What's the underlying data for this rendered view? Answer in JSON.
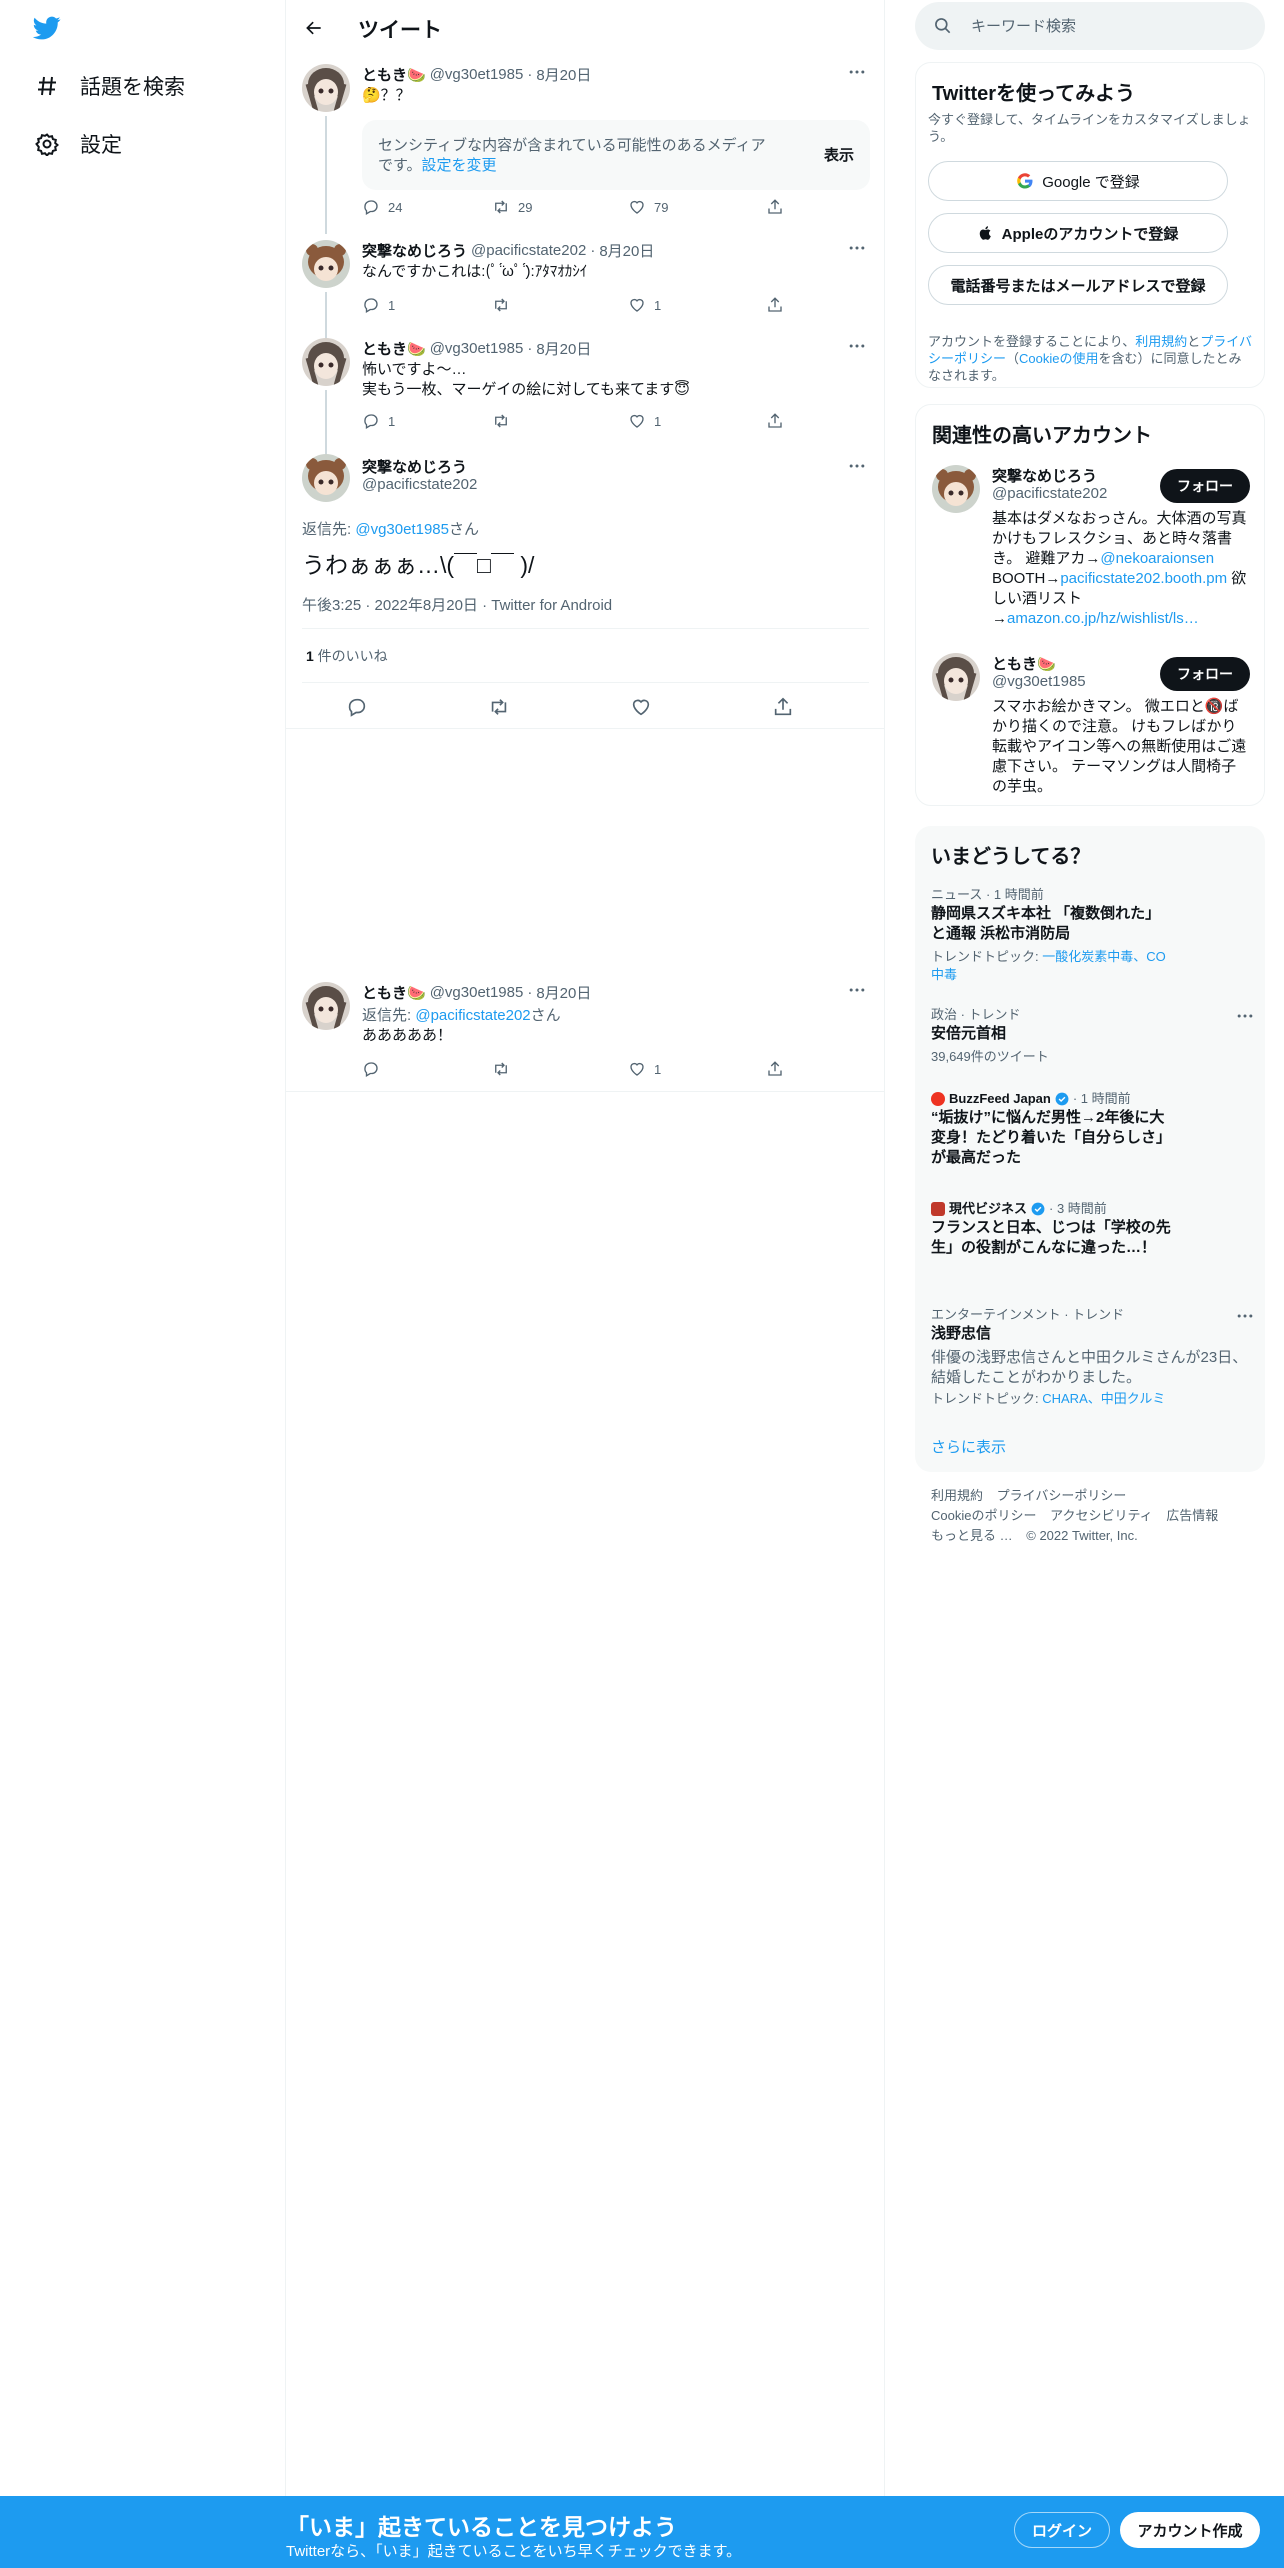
{
  "nav": {
    "explore_label": "話題を検索",
    "settings_label": "設定"
  },
  "header": {
    "title": "ツイート"
  },
  "tweets": [
    {
      "name": "ともき🍉",
      "handle": "@vg30et1985",
      "dot": "·",
      "date": "8月20日",
      "text": "🤔？？",
      "sensitive_text": "センシティブな内容が含まれている可能性のあるメディアです。",
      "sensitive_link": "設定を変更",
      "sensitive_button": "表示",
      "replies": "24",
      "retweets": "29",
      "likes": "79"
    },
    {
      "name": "突撃なめじろう",
      "handle": "@pacificstate202",
      "dot": "·",
      "date": "8月20日",
      "text": "なんですかこれは:(ﾟ ̈́ωﾟ ̈́):ｱﾀﾏｵｶｼｲ",
      "replies": "1",
      "retweets": "",
      "likes": "1"
    },
    {
      "name": "ともき🍉",
      "handle": "@vg30et1985",
      "dot": "·",
      "date": "8月20日",
      "text": "怖いですよ〜…\n実もう一枚、マーゲイの絵に対しても来てます😇",
      "replies": "1",
      "retweets": "",
      "likes": "1"
    }
  ],
  "focus": {
    "name": "突撃なめじろう",
    "handle": "@pacificstate202",
    "reply_to_prefix": "返信先: ",
    "reply_to_handle": "@vg30et1985",
    "reply_to_suffix": "さん",
    "text": "うわぁぁぁ…\\(￣□￣ )/",
    "meta": "午後3:25 · 2022年8月20日 · Twitter for Android",
    "likes_count": "1",
    "likes_label": " 件のいいね"
  },
  "reply": {
    "name": "ともき🍉",
    "handle": "@vg30et1985",
    "dot": "·",
    "date": "8月20日",
    "reply_to_prefix": "返信先: ",
    "reply_to_handle": "@pacificstate202",
    "reply_to_suffix": "さん",
    "text": "あああああ！",
    "replies": "",
    "retweets": "",
    "likes": "1"
  },
  "search": {
    "placeholder": "キーワード検索"
  },
  "signup": {
    "title": "Twitterを使ってみよう",
    "subtitle": "今すぐ登録して、タイムラインをカスタマイズしましょう。",
    "google": "Google で登録",
    "apple": "Appleのアカウントで登録",
    "phone": "電話番号またはメールアドレスで登録",
    "terms_1": "アカウントを登録することにより、",
    "terms_link_1": "利用規約",
    "terms_2": "と",
    "terms_link_2": "プライバシーポリシー",
    "terms_3": "（",
    "terms_link_3": "Cookieの使用",
    "terms_4": "を含む）に同意したとみなされます。"
  },
  "related": {
    "title": "関連性の高いアカウント",
    "follow_label": "フォロー",
    "accounts": [
      {
        "name": "突撃なめじろう",
        "handle": "@pacificstate202",
        "bio_1": "基本はダメなおっさん。大体酒の写真かけもフレスクショ、あと時々落書き。 避難アカ→",
        "bio_link_1": "@nekoaraionsen",
        "bio_2": " BOOTH→",
        "bio_link_2": "pacificstate202.booth.pm",
        "bio_3": " 欲しい酒リスト→",
        "bio_link_3": "amazon.co.jp/hz/wishlist/ls…"
      },
      {
        "name": "ともき🍉",
        "handle": "@vg30et1985",
        "bio_1": "スマホお絵かきマン。 微エロと🔞ばかり描くので注意。 けもフレばかり転載やアイコン等への無断使用はご遠慮下さい。 テーマソングは人間椅子の芋虫。"
      }
    ]
  },
  "trends": {
    "title": "いまどうしてる？",
    "items": [
      {
        "meta": "ニュース · 1 時間前",
        "title": "静岡県スズキ本社 「複数倒れた」と通報 浜松市消防局",
        "sub_prefix": "トレンドトピック: ",
        "sub_links": "一酸化炭素中毒、CO中毒"
      },
      {
        "meta": "政治 · トレンド",
        "title": "安倍元首相",
        "sub": "39,649件のツイート"
      },
      {
        "publisher": "BuzzFeed Japan",
        "time": "· 1 時間前",
        "title": "“垢抜け”に悩んだ男性→2年後に大変身！たどり着いた「自分らしさ」が最高だった"
      },
      {
        "publisher": "現代ビジネス",
        "time": "· 3 時間前",
        "title": "フランスと日本、じつは「学校の先生」の役割がこんなに違った…！"
      },
      {
        "meta": "エンターテインメント · トレンド",
        "title": "浅野忠信",
        "desc": "俳優の浅野忠信さんと中田クルミさんが23日、結婚したことがわかりました。",
        "sub_prefix": "トレンドトピック: ",
        "sub_links": "CHARA、中田クルミ"
      }
    ],
    "show_more": "さらに表示",
    "colors": {
      "buzzfeed": "#ee3322",
      "gendai": "#c0392b",
      "verified": "#1d9bf0"
    }
  },
  "footer": {
    "terms": "利用規約",
    "privacy": "プライバシーポリシー",
    "cookie": "Cookieのポリシー",
    "accessibility": "アクセシビリティ",
    "ads": "広告情報",
    "more": "もっと見る …",
    "copyright": "© 2022 Twitter, Inc."
  },
  "bottom_bar": {
    "title": "「いま」起きていることを見つけよう",
    "subtitle": "Twitterなら、「いま」起きていることをいち早くチェックできます。",
    "login": "ログイン",
    "signup": "アカウント作成"
  },
  "colors": {
    "accent": "#1d9bf0",
    "text": "#0f1419",
    "muted": "#536471"
  }
}
